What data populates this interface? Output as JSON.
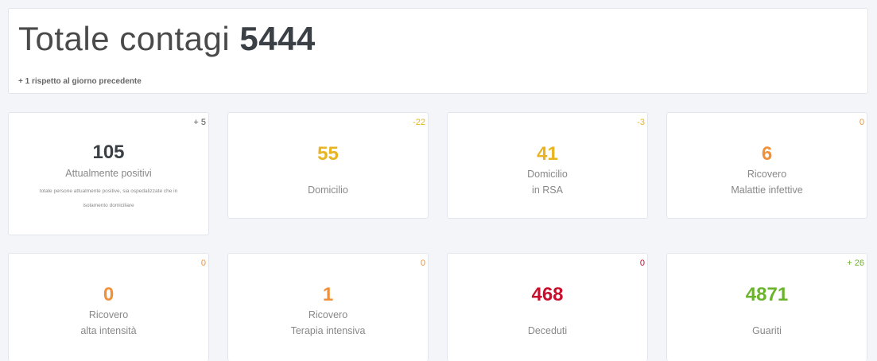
{
  "header": {
    "title_prefix": "Totale contagi",
    "total": "5444",
    "subtitle": "+ 1 rispetto al giorno precedente"
  },
  "cards": [
    {
      "delta": "+ 5",
      "value": "105",
      "label1": "Attualmente positivi",
      "label2": "",
      "desc1": "totale persone attualmente positive, sia ospedalizzate che in",
      "desc2": "isolamento domiciliare"
    },
    {
      "delta": "-22",
      "value": "55",
      "label1": "Domicilio",
      "label2": ""
    },
    {
      "delta": "-3",
      "value": "41",
      "label1": "Domicilio",
      "label2": "in RSA"
    },
    {
      "delta": "0",
      "value": "6",
      "label1": "Ricovero",
      "label2": "Malattie infettive"
    },
    {
      "delta": "0",
      "value": "0",
      "label1": "Ricovero",
      "label2": "alta intensità"
    },
    {
      "delta": "0",
      "value": "1",
      "label1": "Ricovero",
      "label2": "Terapia intensiva"
    },
    {
      "delta": "0",
      "value": "468",
      "label1": "Deceduti",
      "label2": ""
    },
    {
      "delta": "+ 26",
      "value": "4871",
      "label1": "Guariti",
      "label2": ""
    }
  ],
  "colors": {
    "dark": "#3a4046",
    "yellow": "#e8b422",
    "orange": "#f0913a",
    "red": "#c8102e",
    "green": "#6ab42d"
  }
}
